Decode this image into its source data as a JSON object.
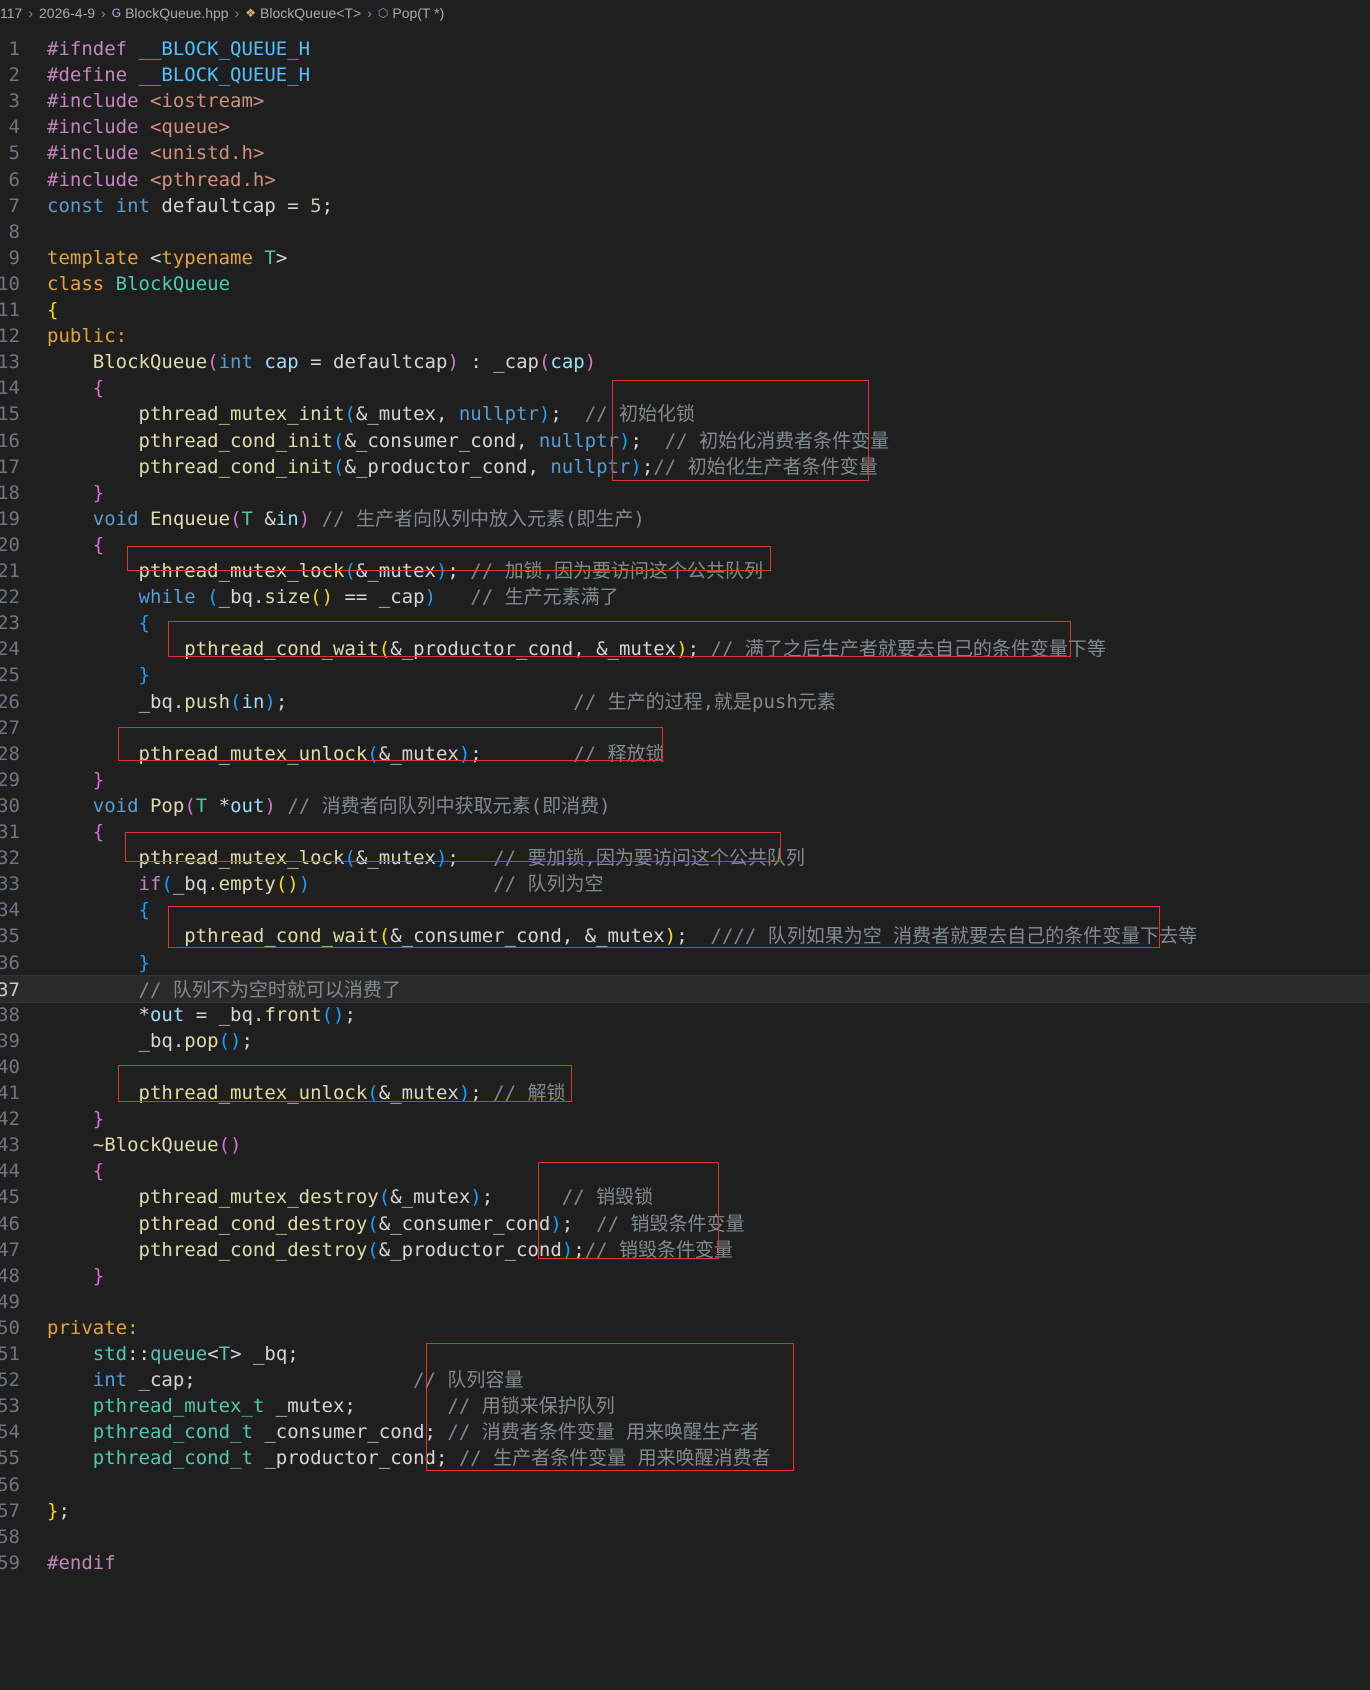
{
  "breadcrumb": [
    "117",
    "2026-4-9",
    "BlockQueue.hpp",
    "BlockQueue<T>",
    "Pop(T *)"
  ],
  "breadcrumb_icons": [
    "",
    "",
    "cpp-file-icon",
    "class-icon",
    "method-icon"
  ],
  "active_line": 37,
  "highlight_color": "#e03333",
  "code_lines": [
    {
      "n": "1",
      "t": [
        [
          "kw-pre",
          "#ifndef"
        ],
        [
          "plain",
          " "
        ],
        [
          "macro",
          "__BLOCK_QUEUE_H"
        ]
      ]
    },
    {
      "n": "2",
      "t": [
        [
          "kw-pre",
          "#define"
        ],
        [
          "plain",
          " "
        ],
        [
          "macro",
          "__BLOCK_QUEUE_H"
        ]
      ]
    },
    {
      "n": "3",
      "t": [
        [
          "kw-pre",
          "#include"
        ],
        [
          "plain",
          " "
        ],
        [
          "str",
          "<iostream>"
        ]
      ]
    },
    {
      "n": "4",
      "t": [
        [
          "kw-pre",
          "#include"
        ],
        [
          "plain",
          " "
        ],
        [
          "str",
          "<queue>"
        ]
      ]
    },
    {
      "n": "5",
      "t": [
        [
          "kw-pre",
          "#include"
        ],
        [
          "plain",
          " "
        ],
        [
          "str",
          "<unistd.h>"
        ]
      ]
    },
    {
      "n": "6",
      "t": [
        [
          "kw-pre",
          "#include"
        ],
        [
          "plain",
          " "
        ],
        [
          "str",
          "<pthread.h>"
        ]
      ]
    },
    {
      "n": "7",
      "t": [
        [
          "kw",
          "const"
        ],
        [
          "plain",
          " "
        ],
        [
          "kw",
          "int"
        ],
        [
          "plain",
          " defaultcap = "
        ],
        [
          "num",
          "5"
        ],
        [
          "plain",
          ";"
        ]
      ]
    },
    {
      "n": "8",
      "t": []
    },
    {
      "n": "9",
      "t": [
        [
          "tpl",
          "template"
        ],
        [
          "plain",
          " <"
        ],
        [
          "tpl",
          "typename"
        ],
        [
          "plain",
          " "
        ],
        [
          "ty",
          "T"
        ],
        [
          "plain",
          ">"
        ]
      ]
    },
    {
      "n": "10",
      "t": [
        [
          "tpl",
          "class"
        ],
        [
          "plain",
          " "
        ],
        [
          "ty",
          "BlockQueue"
        ]
      ]
    },
    {
      "n": "11",
      "t": [
        [
          "b1",
          "{"
        ]
      ]
    },
    {
      "n": "12",
      "t": [
        [
          "tpl",
          "public:"
        ]
      ]
    },
    {
      "n": "13",
      "t": [
        [
          "plain",
          "    "
        ],
        [
          "fn",
          "BlockQueue"
        ],
        [
          "b2",
          "("
        ],
        [
          "kw",
          "int"
        ],
        [
          "plain",
          " "
        ],
        [
          "var",
          "cap"
        ],
        [
          "plain",
          " = defaultcap"
        ],
        [
          "b2",
          ")"
        ],
        [
          "plain",
          " : _cap"
        ],
        [
          "b2",
          "("
        ],
        [
          "var",
          "cap"
        ],
        [
          "b2",
          ")"
        ]
      ]
    },
    {
      "n": "14",
      "t": [
        [
          "plain",
          "    "
        ],
        [
          "b2",
          "{"
        ]
      ]
    },
    {
      "n": "15",
      "t": [
        [
          "plain",
          "        "
        ],
        [
          "fn",
          "pthread_mutex_init"
        ],
        [
          "b3",
          "("
        ],
        [
          "plain",
          "&_mutex, "
        ],
        [
          "kw",
          "nullptr"
        ],
        [
          "b3",
          ")"
        ],
        [
          "plain",
          ";  "
        ],
        [
          "com",
          "// 初始化锁"
        ]
      ]
    },
    {
      "n": "16",
      "t": [
        [
          "plain",
          "        "
        ],
        [
          "fn",
          "pthread_cond_init"
        ],
        [
          "b3",
          "("
        ],
        [
          "plain",
          "&_consumer_cond, "
        ],
        [
          "kw",
          "nullptr"
        ],
        [
          "b3",
          ")"
        ],
        [
          "plain",
          ";  "
        ],
        [
          "com",
          "// 初始化消费者条件变量"
        ]
      ]
    },
    {
      "n": "17",
      "t": [
        [
          "plain",
          "        "
        ],
        [
          "fn",
          "pthread_cond_init"
        ],
        [
          "b3",
          "("
        ],
        [
          "plain",
          "&_productor_cond, "
        ],
        [
          "kw",
          "nullptr"
        ],
        [
          "b3",
          ")"
        ],
        [
          "plain",
          ";"
        ],
        [
          "com",
          "// 初始化生产者条件变量"
        ]
      ]
    },
    {
      "n": "18",
      "t": [
        [
          "plain",
          "    "
        ],
        [
          "b2",
          "}"
        ]
      ]
    },
    {
      "n": "19",
      "t": [
        [
          "plain",
          "    "
        ],
        [
          "kw",
          "void"
        ],
        [
          "plain",
          " "
        ],
        [
          "fn",
          "Enqueue"
        ],
        [
          "b2",
          "("
        ],
        [
          "ty",
          "T"
        ],
        [
          "plain",
          " &"
        ],
        [
          "var",
          "in"
        ],
        [
          "b2",
          ")"
        ],
        [
          "plain",
          " "
        ],
        [
          "com",
          "// 生产者向队列中放入元素(即生产)"
        ]
      ]
    },
    {
      "n": "20",
      "t": [
        [
          "plain",
          "    "
        ],
        [
          "b2",
          "{"
        ]
      ]
    },
    {
      "n": "21",
      "t": [
        [
          "plain",
          "        "
        ],
        [
          "fn",
          "pthread_mutex_lock"
        ],
        [
          "b3",
          "("
        ],
        [
          "plain",
          "&_mutex"
        ],
        [
          "b3",
          ")"
        ],
        [
          "plain",
          "; "
        ],
        [
          "com",
          "// 加锁,因为要访问这个公共队列"
        ]
      ]
    },
    {
      "n": "22",
      "t": [
        [
          "plain",
          "        "
        ],
        [
          "kw",
          "while"
        ],
        [
          "plain",
          " "
        ],
        [
          "b3",
          "("
        ],
        [
          "plain",
          "_bq."
        ],
        [
          "fn",
          "size"
        ],
        [
          "b1",
          "()"
        ],
        [
          "plain",
          " == _cap"
        ],
        [
          "b3",
          ")"
        ],
        [
          "plain",
          "   "
        ],
        [
          "com",
          "// 生产元素满了"
        ]
      ]
    },
    {
      "n": "23",
      "t": [
        [
          "plain",
          "        "
        ],
        [
          "b3",
          "{"
        ]
      ]
    },
    {
      "n": "24",
      "t": [
        [
          "plain",
          "            "
        ],
        [
          "fn",
          "pthread_cond_wait"
        ],
        [
          "b1",
          "("
        ],
        [
          "plain",
          "&_productor_cond, &_mutex"
        ],
        [
          "b1",
          ")"
        ],
        [
          "plain",
          "; "
        ],
        [
          "com",
          "// 满了之后生产者就要去自己的条件变量下等"
        ]
      ]
    },
    {
      "n": "25",
      "t": [
        [
          "plain",
          "        "
        ],
        [
          "b3",
          "}"
        ]
      ]
    },
    {
      "n": "26",
      "t": [
        [
          "plain",
          "        _bq."
        ],
        [
          "fn",
          "push"
        ],
        [
          "b3",
          "("
        ],
        [
          "var",
          "in"
        ],
        [
          "b3",
          ")"
        ],
        [
          "plain",
          ";                         "
        ],
        [
          "com",
          "// 生产的过程,就是push元素"
        ]
      ]
    },
    {
      "n": "27",
      "t": []
    },
    {
      "n": "28",
      "t": [
        [
          "plain",
          "        "
        ],
        [
          "fn",
          "pthread_mutex_unlock"
        ],
        [
          "b3",
          "("
        ],
        [
          "plain",
          "&_mutex"
        ],
        [
          "b3",
          ")"
        ],
        [
          "plain",
          ";        "
        ],
        [
          "com",
          "// 释放锁"
        ]
      ]
    },
    {
      "n": "29",
      "t": [
        [
          "plain",
          "    "
        ],
        [
          "b2",
          "}"
        ]
      ]
    },
    {
      "n": "30",
      "t": [
        [
          "plain",
          "    "
        ],
        [
          "kw",
          "void"
        ],
        [
          "plain",
          " "
        ],
        [
          "fn",
          "Pop"
        ],
        [
          "b2",
          "("
        ],
        [
          "ty",
          "T"
        ],
        [
          "plain",
          " *"
        ],
        [
          "var",
          "out"
        ],
        [
          "b2",
          ")"
        ],
        [
          "plain",
          " "
        ],
        [
          "com",
          "// 消费者向队列中获取元素(即消费)"
        ]
      ]
    },
    {
      "n": "31",
      "t": [
        [
          "plain",
          "    "
        ],
        [
          "b2",
          "{"
        ]
      ]
    },
    {
      "n": "32",
      "t": [
        [
          "plain",
          "        "
        ],
        [
          "fn",
          "pthread_mutex_lock"
        ],
        [
          "b3",
          "("
        ],
        [
          "plain",
          "&_mutex"
        ],
        [
          "b3",
          ")"
        ],
        [
          "plain",
          ";   "
        ],
        [
          "com",
          "// 要加锁,因为要访问这个公共队列"
        ]
      ]
    },
    {
      "n": "33",
      "t": [
        [
          "plain",
          "        "
        ],
        [
          "kwo",
          "if"
        ],
        [
          "b3",
          "("
        ],
        [
          "plain",
          "_bq."
        ],
        [
          "fn",
          "empty"
        ],
        [
          "b1",
          "()"
        ],
        [
          "b3",
          ")"
        ],
        [
          "plain",
          "                "
        ],
        [
          "com",
          "// 队列为空"
        ]
      ]
    },
    {
      "n": "34",
      "t": [
        [
          "plain",
          "        "
        ],
        [
          "b3",
          "{"
        ]
      ]
    },
    {
      "n": "35",
      "t": [
        [
          "plain",
          "            "
        ],
        [
          "fn",
          "pthread_cond_wait"
        ],
        [
          "b1",
          "("
        ],
        [
          "plain",
          "&_consumer_cond, &_mutex"
        ],
        [
          "b1",
          ")"
        ],
        [
          "plain",
          ";  "
        ],
        [
          "com",
          "//// 队列如果为空 消费者就要去自己的条件变量下去等"
        ]
      ]
    },
    {
      "n": "36",
      "t": [
        [
          "plain",
          "        "
        ],
        [
          "b3",
          "}"
        ]
      ]
    },
    {
      "n": "37",
      "t": [
        [
          "plain",
          "        "
        ],
        [
          "com",
          "// 队列不为空时就可以消费了"
        ]
      ]
    },
    {
      "n": "38",
      "t": [
        [
          "plain",
          "        *"
        ],
        [
          "var",
          "out"
        ],
        [
          "plain",
          " = _bq."
        ],
        [
          "fn",
          "front"
        ],
        [
          "b3",
          "()"
        ],
        [
          "plain",
          ";"
        ]
      ]
    },
    {
      "n": "39",
      "t": [
        [
          "plain",
          "        _bq."
        ],
        [
          "fn",
          "pop"
        ],
        [
          "b3",
          "()"
        ],
        [
          "plain",
          ";"
        ]
      ]
    },
    {
      "n": "40",
      "t": []
    },
    {
      "n": "41",
      "t": [
        [
          "plain",
          "        "
        ],
        [
          "fn",
          "pthread_mutex_unlock"
        ],
        [
          "b3",
          "("
        ],
        [
          "plain",
          "&_mutex"
        ],
        [
          "b3",
          ")"
        ],
        [
          "plain",
          "; "
        ],
        [
          "com",
          "// 解锁"
        ]
      ]
    },
    {
      "n": "42",
      "t": [
        [
          "plain",
          "    "
        ],
        [
          "b2",
          "}"
        ]
      ]
    },
    {
      "n": "43",
      "t": [
        [
          "plain",
          "    "
        ],
        [
          "fn",
          "~BlockQueue"
        ],
        [
          "b2",
          "()"
        ]
      ]
    },
    {
      "n": "44",
      "t": [
        [
          "plain",
          "    "
        ],
        [
          "b2",
          "{"
        ]
      ]
    },
    {
      "n": "45",
      "t": [
        [
          "plain",
          "        "
        ],
        [
          "fn",
          "pthread_mutex_destroy"
        ],
        [
          "b3",
          "("
        ],
        [
          "plain",
          "&_mutex"
        ],
        [
          "b3",
          ")"
        ],
        [
          "plain",
          ";      "
        ],
        [
          "com",
          "// 销毁锁"
        ]
      ]
    },
    {
      "n": "46",
      "t": [
        [
          "plain",
          "        "
        ],
        [
          "fn",
          "pthread_cond_destroy"
        ],
        [
          "b3",
          "("
        ],
        [
          "plain",
          "&_consumer_cond"
        ],
        [
          "b3",
          ")"
        ],
        [
          "plain",
          ";  "
        ],
        [
          "com",
          "// 销毁条件变量"
        ]
      ]
    },
    {
      "n": "47",
      "t": [
        [
          "plain",
          "        "
        ],
        [
          "fn",
          "pthread_cond_destroy"
        ],
        [
          "b3",
          "("
        ],
        [
          "plain",
          "&_productor_cond"
        ],
        [
          "b3",
          ")"
        ],
        [
          "plain",
          ";"
        ],
        [
          "com",
          "// 销毁条件变量"
        ]
      ]
    },
    {
      "n": "48",
      "t": [
        [
          "plain",
          "    "
        ],
        [
          "b2",
          "}"
        ]
      ]
    },
    {
      "n": "49",
      "t": []
    },
    {
      "n": "50",
      "t": [
        [
          "tpl",
          "private:"
        ]
      ]
    },
    {
      "n": "51",
      "t": [
        [
          "plain",
          "    "
        ],
        [
          "ty",
          "std"
        ],
        [
          "plain",
          "::"
        ],
        [
          "ty",
          "queue"
        ],
        [
          "plain",
          "<"
        ],
        [
          "ty",
          "T"
        ],
        [
          "plain",
          "> _bq;"
        ]
      ]
    },
    {
      "n": "52",
      "t": [
        [
          "plain",
          "    "
        ],
        [
          "kw",
          "int"
        ],
        [
          "plain",
          " _cap;                   "
        ],
        [
          "com",
          "// 队列容量"
        ]
      ]
    },
    {
      "n": "53",
      "t": [
        [
          "plain",
          "    "
        ],
        [
          "ty",
          "pthread_mutex_t"
        ],
        [
          "plain",
          " _mutex;        "
        ],
        [
          "com",
          "// 用锁来保护队列"
        ]
      ]
    },
    {
      "n": "54",
      "t": [
        [
          "plain",
          "    "
        ],
        [
          "ty",
          "pthread_cond_t"
        ],
        [
          "plain",
          " _consumer_cond; "
        ],
        [
          "com",
          "// 消费者条件变量 用来唤醒生产者"
        ]
      ]
    },
    {
      "n": "55",
      "t": [
        [
          "plain",
          "    "
        ],
        [
          "ty",
          "pthread_cond_t"
        ],
        [
          "plain",
          " _productor_cond; "
        ],
        [
          "com",
          "// 生产者条件变量 用来唤醒消费者"
        ]
      ]
    },
    {
      "n": "56",
      "t": []
    },
    {
      "n": "57",
      "t": [
        [
          "b1",
          "}"
        ],
        [
          "plain",
          ";"
        ]
      ]
    },
    {
      "n": "58",
      "t": []
    },
    {
      "n": "59",
      "t": [
        [
          "kw-pre",
          "#endif"
        ]
      ]
    }
  ]
}
